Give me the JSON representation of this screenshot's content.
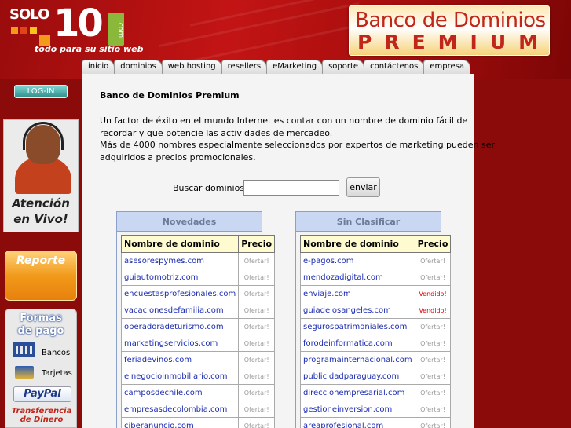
{
  "colors": {
    "brand_red": "#c0261a",
    "nav_bg": "#dcdcdc",
    "panel_header": "#c9d7f2",
    "table_header": "#fffbd0",
    "link": "#1a2bb0",
    "sold": "#dd0000"
  },
  "logo": {
    "solo": "SOLO",
    "ten": "10",
    "com": ".com",
    "tagline": "todo para su sitio web"
  },
  "banner": {
    "line1": "Banco de Dominios",
    "line2": "PREMIUM"
  },
  "nav": [
    "inicio",
    "dominios",
    "web hosting",
    "resellers",
    "eMarketing",
    "soporte",
    "contáctenos",
    "empresa"
  ],
  "sidebar": {
    "login": "LOG-IN",
    "support_label": [
      "Atención",
      "en Vivo!"
    ],
    "report": "Reporte",
    "payments_title": [
      "Formas",
      "de pago"
    ],
    "payments": {
      "banks": "Bancos",
      "cards": "Tarjetas",
      "paypal": "PayPal",
      "transfer": [
        "Transferencia",
        "de Dinero"
      ]
    }
  },
  "main": {
    "title": "Banco de Dominios Premium",
    "para1": [
      "Un factor de éxito en el mundo Internet es contar con un nombre de dominio fácil de",
      "recordar y que potencie las actividades de mercadeo."
    ],
    "para2": [
      "Más de 4000 nombres especialmente seleccionados por expertos de marketing pueden ser",
      "adquiridos a precios promocionales."
    ],
    "search_label": "Buscar dominios:",
    "search_value": "",
    "search_button": "enviar"
  },
  "panels": [
    {
      "title": "Novedades",
      "col_domain": "Nombre de dominio",
      "col_price": "Precio",
      "rows": [
        {
          "domain": "asesorespymes.com",
          "price": "Ofertar!"
        },
        {
          "domain": "guiautomotriz.com",
          "price": "Ofertar!"
        },
        {
          "domain": "encuestasprofesionales.com",
          "price": "Ofertar!"
        },
        {
          "domain": "vacacionesdefamilia.com",
          "price": "Ofertar!"
        },
        {
          "domain": "operadoradeturismo.com",
          "price": "Ofertar!"
        },
        {
          "domain": "marketingservicios.com",
          "price": "Ofertar!"
        },
        {
          "domain": "feriadevinos.com",
          "price": "Ofertar!"
        },
        {
          "domain": "elnegocioinmobiliario.com",
          "price": "Ofertar!"
        },
        {
          "domain": "camposdechile.com",
          "price": "Ofertar!"
        },
        {
          "domain": "empresasdecolombia.com",
          "price": "Ofertar!"
        },
        {
          "domain": "ciberanuncio.com",
          "price": "Ofertar!"
        }
      ]
    },
    {
      "title": "Sin Clasificar",
      "col_domain": "Nombre de dominio",
      "col_price": "Precio",
      "rows": [
        {
          "domain": "e-pagos.com",
          "price": "Ofertar!"
        },
        {
          "domain": "mendozadigital.com",
          "price": "Ofertar!"
        },
        {
          "domain": "enviaje.com",
          "price": "Vendido!"
        },
        {
          "domain": "guiadelosangeles.com",
          "price": "Vendido!"
        },
        {
          "domain": "segurospatrimoniales.com",
          "price": "Ofertar!"
        },
        {
          "domain": "forodeinformatica.com",
          "price": "Ofertar!"
        },
        {
          "domain": "programainternacional.com",
          "price": "Ofertar!"
        },
        {
          "domain": "publicidadparaguay.com",
          "price": "Ofertar!"
        },
        {
          "domain": "direccionempresarial.com",
          "price": "Ofertar!"
        },
        {
          "domain": "gestioneinversion.com",
          "price": "Ofertar!"
        },
        {
          "domain": "areaprofesional.com",
          "price": "Ofertar!"
        }
      ]
    }
  ]
}
